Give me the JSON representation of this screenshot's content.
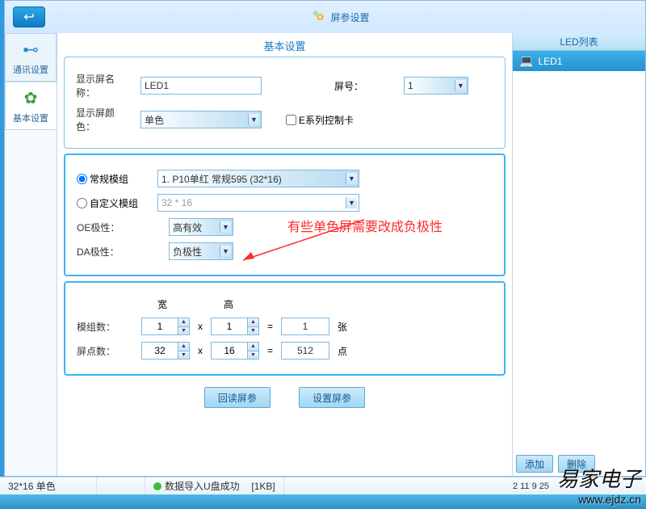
{
  "title": "屏参设置",
  "sidebar": {
    "comm": "通讯设置",
    "basic": "基本设置"
  },
  "basic_panel_title": "基本设置",
  "labels": {
    "screen_name": "显示屏名称：",
    "screen_no": "屏号：",
    "screen_color": "显示屏颜色：",
    "e_series": "E系列控制卡",
    "normal_module": "常规模组",
    "custom_module": "自定义模组",
    "oe_polarity": "OE极性：",
    "da_polarity": "DA极性：",
    "width_h": "宽",
    "height_h": "高",
    "module_count": "模组数：",
    "pixel_count": "屏点数：",
    "unit_sheet": "张",
    "unit_point": "点"
  },
  "values": {
    "screen_name": "LED1",
    "screen_no": "1",
    "screen_color": "单色",
    "normal_module": "1. P10单红 常规595 (32*16)",
    "custom_module": "32 * 16",
    "oe_polarity": "高有效",
    "da_polarity": "负极性",
    "mod_w": "1",
    "mod_h": "1",
    "mod_total": "1",
    "pix_w": "32",
    "pix_h": "16",
    "pix_total": "512"
  },
  "annotation": "有些单色屏需要改成负极性",
  "buttons": {
    "read": "回读屏参",
    "set": "设置屏参",
    "add": "添加",
    "delete": "删除"
  },
  "led_list": {
    "header": "LED列表",
    "items": [
      "LED1"
    ]
  },
  "status": {
    "res": "32*16 单色",
    "msg": "数据导入U盘成功",
    "size": "[1KB]"
  },
  "watermark": {
    "name": "易家电子",
    "url": "www.ejdz.cn"
  },
  "clock": "2    11    9    25"
}
